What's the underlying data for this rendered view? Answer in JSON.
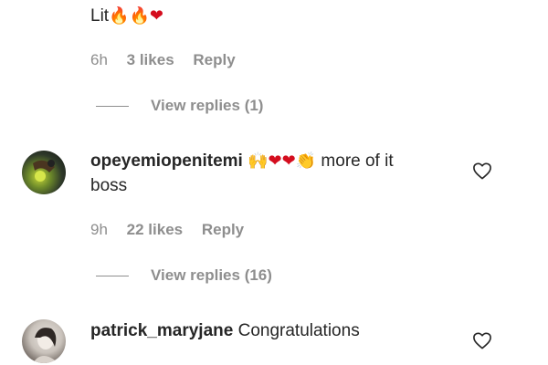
{
  "comments": [
    {
      "text": "Lit",
      "emojis": [
        "🔥",
        "🔥",
        "❤"
      ],
      "time": "6h",
      "likes": "3 likes",
      "reply": "Reply",
      "view_replies": "View replies (1)"
    },
    {
      "username": "opeyemiopenitemi",
      "emojis": [
        "🙌",
        "❤",
        "❤",
        "👏"
      ],
      "text": "more of it",
      "text_line2": "boss",
      "time": "9h",
      "likes": "22 likes",
      "reply": "Reply",
      "view_replies": "View replies (16)",
      "like_icon": "heart-outline-icon"
    },
    {
      "username": "patrick_maryjane",
      "text": "Congratulations",
      "like_icon": "heart-outline-icon"
    }
  ],
  "colors": {
    "text": "#262626",
    "secondary": "#8e8e8e",
    "link": "#00376b"
  }
}
